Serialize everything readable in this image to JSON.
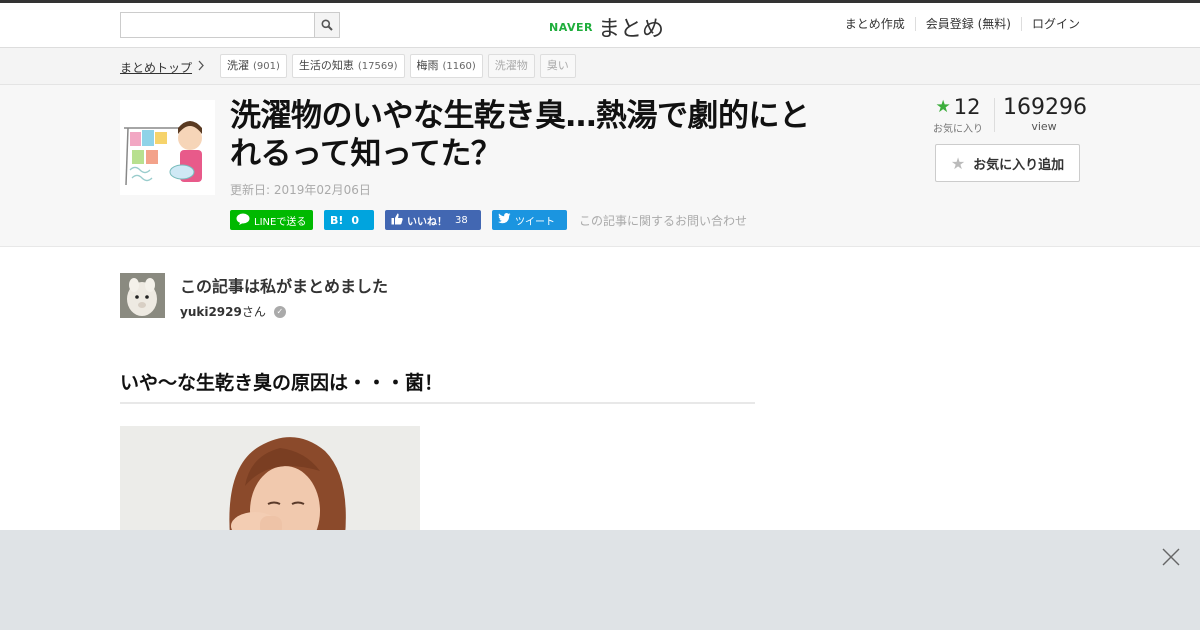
{
  "header": {
    "search_placeholder": "",
    "logo_brand": "NAVER",
    "logo_name": "まとめ",
    "nav": [
      "まとめ作成",
      "会員登録 (無料)",
      "ログイン"
    ]
  },
  "breadcrumb": {
    "top": "まとめトップ",
    "tags": [
      {
        "label": "洗濯",
        "count": "(901)"
      },
      {
        "label": "生活の知恵",
        "count": "(17569)"
      },
      {
        "label": "梅雨",
        "count": "(1160)"
      },
      {
        "label": "洗濯物",
        "count": ""
      },
      {
        "label": "臭い",
        "count": ""
      }
    ]
  },
  "article": {
    "title": "洗濯物のいやな生乾き臭…熱湯で劇的にとれるって知ってた？",
    "updated": "更新日: 2019年02月06日",
    "share": {
      "line": "LINEで送る",
      "hatena_icon": "B!",
      "hatena_count": "0",
      "fb_label": "いいね！",
      "fb_count": "38",
      "tweet": "ツイート",
      "inquiry": "この記事に関するお問い合わせ"
    },
    "favorites": "12",
    "favorites_label": "お気に入り",
    "views": "169296",
    "views_label": "view",
    "fav_button": "お気に入り追加"
  },
  "author": {
    "heading": "この記事は私がまとめました",
    "name": "yuki2929",
    "suffix": "さん"
  },
  "section": {
    "heading": "いや～な生乾き臭の原因は・・・菌！"
  },
  "colors": {
    "naver_green": "#1fae3c",
    "line_green": "#00b900",
    "hatena_blue": "#00a4de",
    "facebook_blue": "#4267b2",
    "twitter_blue": "#1b95e0",
    "star_green": "#3cae3c"
  },
  "icons": [
    "search-icon",
    "chevron-right-icon",
    "star-icon",
    "verified-icon",
    "close-icon"
  ]
}
